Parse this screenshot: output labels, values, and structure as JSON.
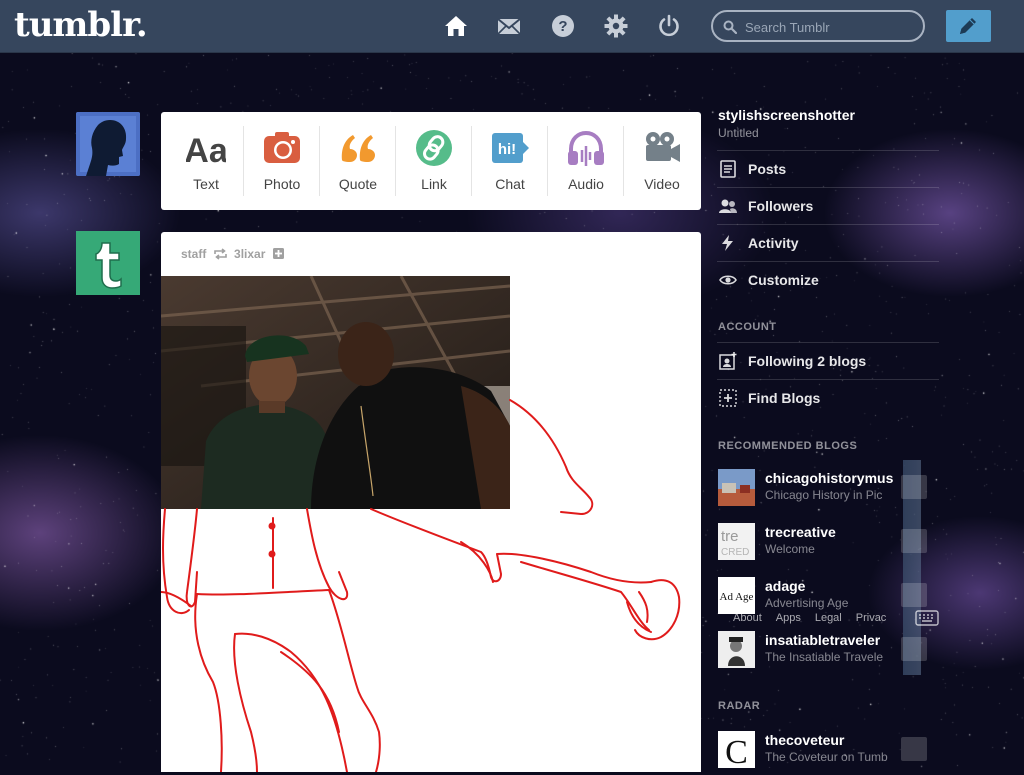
{
  "header": {
    "logo": "tumblr.",
    "search_placeholder": "Search Tumblr",
    "nav": [
      {
        "icon": "home-icon"
      },
      {
        "icon": "mail-icon"
      },
      {
        "icon": "help-icon"
      },
      {
        "icon": "gear-icon"
      },
      {
        "icon": "power-icon"
      }
    ],
    "compose_icon": "pencil-icon",
    "colors": {
      "bar": "#36465d",
      "compose": "#529ecc"
    }
  },
  "post_types": [
    {
      "label": "Text",
      "icon": "text-icon",
      "color": "#444444"
    },
    {
      "label": "Photo",
      "icon": "camera-icon",
      "color": "#d95e40"
    },
    {
      "label": "Quote",
      "icon": "quote-icon",
      "color": "#f2992e"
    },
    {
      "label": "Link",
      "icon": "link-icon",
      "color": "#56bc8a"
    },
    {
      "label": "Chat",
      "icon": "chat-icon",
      "color": "#529ecc"
    },
    {
      "label": "Audio",
      "icon": "headphones-icon",
      "color": "#a77dc2"
    },
    {
      "label": "Video",
      "icon": "video-camera-icon",
      "color": "#748089"
    }
  ],
  "post": {
    "reblogger": "staff",
    "source": "3lixar"
  },
  "sidebar": {
    "blog_name": "stylishscreenshotter",
    "blog_sub": "Untitled",
    "menu": [
      {
        "label": "Posts",
        "icon": "posts-icon"
      },
      {
        "label": "Followers",
        "icon": "followers-icon"
      },
      {
        "label": "Activity",
        "icon": "activity-icon"
      },
      {
        "label": "Customize",
        "icon": "eye-icon"
      }
    ],
    "account_heading": "ACCOUNT",
    "account": [
      {
        "label": "Following 2 blogs",
        "icon": "following-icon"
      },
      {
        "label": "Find Blogs",
        "icon": "find-blogs-icon"
      }
    ],
    "recommended_heading": "RECOMMENDED BLOGS",
    "recommended": [
      {
        "name": "chicagohistorymus",
        "sub": "Chicago History in Pic"
      },
      {
        "name": "trecreative",
        "sub": "Welcome"
      },
      {
        "name": "adage",
        "sub": "Advertising Age"
      },
      {
        "name": "insatiabletraveler",
        "sub": "The Insatiable Travele"
      }
    ],
    "adage_menu": [
      "About",
      "Apps",
      "Legal",
      "Privac"
    ],
    "radar_heading": "RADAR",
    "radar": {
      "name": "thecoveteur",
      "sub": "The Coveteur on Tumb"
    }
  }
}
